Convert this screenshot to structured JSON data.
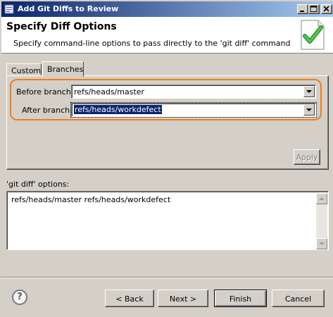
{
  "window": {
    "title": "Add Git Diffs to Review"
  },
  "header": {
    "title": "Specify Diff Options",
    "description": "Specify command-line options to pass directly to the 'git diff' command",
    "icon": "checkmark-document-icon"
  },
  "tabs": [
    {
      "label": "Custom",
      "selected": false
    },
    {
      "label": "Branches",
      "selected": true
    }
  ],
  "branches": {
    "before_label": "Before branch:",
    "before_value": "refs/heads/master",
    "after_label": "After branch:",
    "after_value": "refs/heads/workdefect",
    "apply_label": "Apply",
    "apply_enabled": false,
    "highlight_color": "#f07d1a"
  },
  "git_diff": {
    "label": "'git diff' options:",
    "value": "refs/heads/master refs/heads/workdefect"
  },
  "footer": {
    "help_symbol": "?",
    "back_label": "< Back",
    "next_label": "Next >",
    "finish_label": "Finish",
    "cancel_label": "Cancel"
  }
}
